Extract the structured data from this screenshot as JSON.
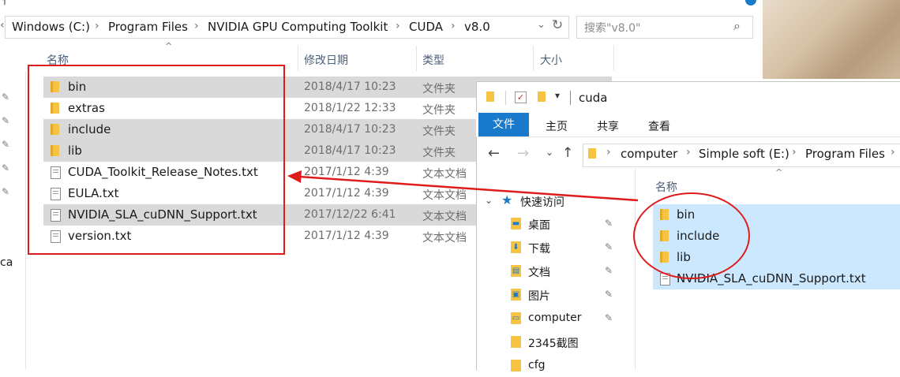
{
  "back_window": {
    "breadcrumb": [
      "Windows (C:)",
      "Program Files",
      "NVIDIA GPU Computing Toolkit",
      "CUDA",
      "v8.0"
    ],
    "search_placeholder": "搜索\"v8.0\"",
    "columns": {
      "name": "名称",
      "date": "修改日期",
      "type": "类型",
      "size": "大小"
    },
    "side_text": "ca",
    "files": [
      {
        "name": "bin",
        "date": "2018/4/17 10:23",
        "type": "文件夹",
        "kind": "folder",
        "selected": true
      },
      {
        "name": "extras",
        "date": "2018/1/22 12:33",
        "type": "文件夹",
        "kind": "folder",
        "selected": false
      },
      {
        "name": "include",
        "date": "2018/4/17 10:23",
        "type": "文件夹",
        "kind": "folder",
        "selected": true
      },
      {
        "name": "lib",
        "date": "2018/4/17 10:23",
        "type": "文件夹",
        "kind": "folder",
        "selected": true
      },
      {
        "name": "CUDA_Toolkit_Release_Notes.txt",
        "date": "2017/1/12 4:39",
        "type": "文本文档",
        "kind": "file",
        "selected": false
      },
      {
        "name": "EULA.txt",
        "date": "2017/1/12 4:39",
        "type": "文本文档",
        "kind": "file",
        "selected": false
      },
      {
        "name": "NVIDIA_SLA_cuDNN_Support.txt",
        "date": "2017/12/22 6:41",
        "type": "文本文档",
        "kind": "file",
        "selected": true
      },
      {
        "name": "version.txt",
        "date": "2017/1/12 4:39",
        "type": "文本文档",
        "kind": "file",
        "selected": false
      }
    ]
  },
  "front_window": {
    "title": "cuda",
    "ribbon_tabs": [
      "文件",
      "主页",
      "共享",
      "查看"
    ],
    "breadcrumb": [
      "computer",
      "Simple soft (E:)",
      "Program Files"
    ],
    "column_name": "名称",
    "quick_access_label": "快速访问",
    "nav_items": [
      {
        "label": "桌面",
        "pinned": true,
        "icon": "desktop-icon"
      },
      {
        "label": "下载",
        "pinned": true,
        "icon": "download-icon"
      },
      {
        "label": "文档",
        "pinned": true,
        "icon": "document-icon"
      },
      {
        "label": "图片",
        "pinned": true,
        "icon": "picture-icon"
      },
      {
        "label": "computer",
        "pinned": true,
        "icon": "computer-icon"
      },
      {
        "label": "2345截图",
        "pinned": false,
        "icon": "folder-icon"
      },
      {
        "label": "cfg",
        "pinned": false,
        "icon": "folder-icon"
      }
    ],
    "files": [
      {
        "name": "bin",
        "kind": "folder"
      },
      {
        "name": "include",
        "kind": "folder"
      },
      {
        "name": "lib",
        "kind": "folder"
      },
      {
        "name": "NVIDIA_SLA_cuDNN_Support.txt",
        "kind": "file"
      }
    ]
  },
  "colors": {
    "annotation_red": "#e01b1b",
    "selection_blue": "#cce8ff",
    "selection_gray": "#d9d9d9",
    "ribbon_blue": "#1979ca"
  }
}
